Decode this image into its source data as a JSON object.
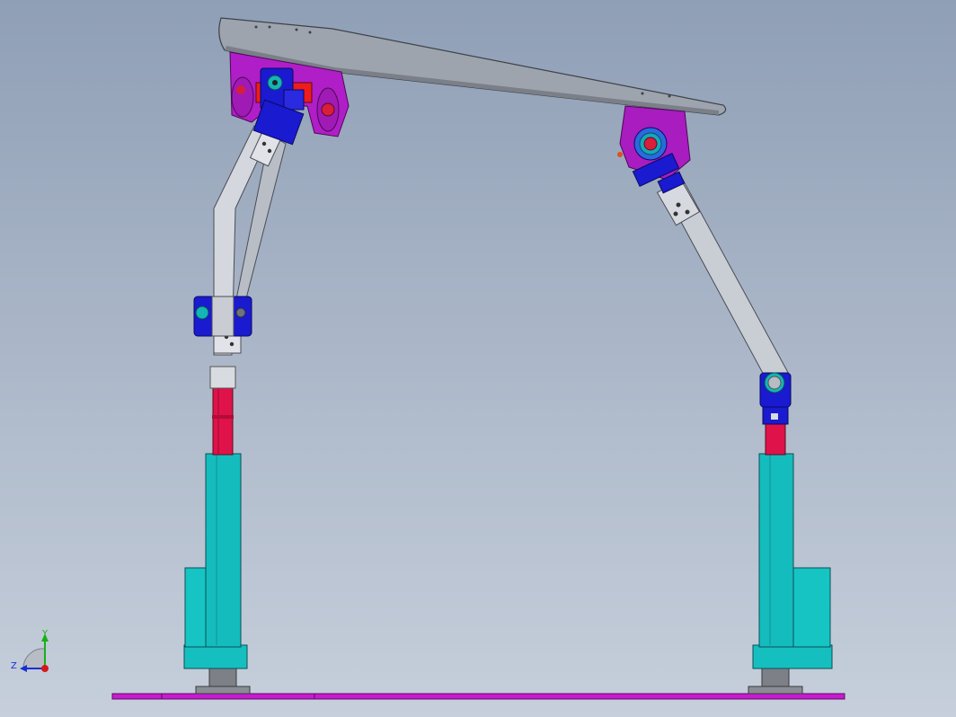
{
  "triad": {
    "y_label": "Y",
    "z_label": "Z"
  },
  "colors": {
    "background_top": "#8f9fb6",
    "background_bottom": "#c6cfdb",
    "platform": "#9ea4ad",
    "bracket_magenta": "#b01ec8",
    "joint_blue": "#1a1ad0",
    "link_silver": "#c8ccd3",
    "rod_red": "#e0124a",
    "actuator_cyan": "#15bfc0",
    "base_plate": "#c81bd0"
  }
}
